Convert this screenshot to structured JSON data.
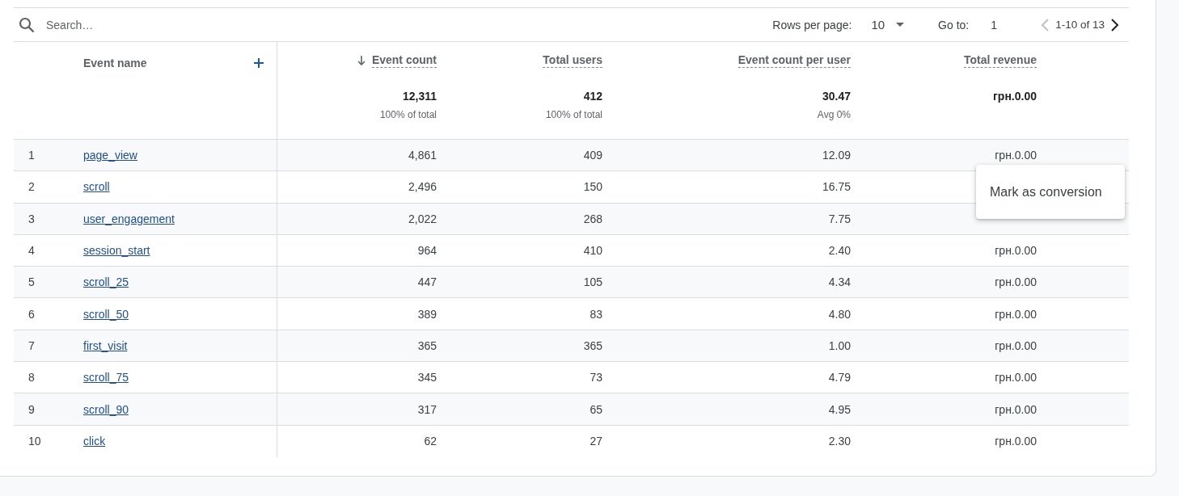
{
  "toolbar": {
    "search": {
      "placeholder": "Search…"
    },
    "rows_per_page_label": "Rows per page:",
    "rows_per_page": "10",
    "goto_label": "Go to:",
    "goto_value": "1",
    "range": "1-10 of 13",
    "previous_disabled": true,
    "next_disabled": false
  },
  "columns": [
    {
      "label": "Event name",
      "kind": "dimension"
    },
    {
      "label": "Event count",
      "kind": "metric",
      "sorted": true
    },
    {
      "label": "Total users",
      "kind": "metric",
      "sorted": false
    },
    {
      "label": "Event count per user",
      "kind": "metric",
      "sorted": false
    },
    {
      "label": "Total revenue",
      "kind": "metric",
      "sorted": false
    }
  ],
  "totals": [
    {
      "value": "12,311",
      "note": "100% of total"
    },
    {
      "value": "412",
      "note": "100% of total"
    },
    {
      "value": "30.47",
      "note": "Avg 0%"
    },
    {
      "value": "грн.0.00"
    }
  ],
  "rows": [
    {
      "rank": "1",
      "name": "page_view",
      "values": [
        "4,861",
        "409",
        "12.09",
        "грн.0.00"
      ]
    },
    {
      "rank": "2",
      "name": "scroll",
      "values": [
        "2,496",
        "150",
        "16.75"
      ]
    },
    {
      "rank": "3",
      "name": "user_engagement",
      "values": [
        "2,022",
        "268",
        "7.75"
      ]
    },
    {
      "rank": "4",
      "name": "session_start",
      "values": [
        "964",
        "410",
        "2.40",
        "грн.0.00"
      ]
    },
    {
      "rank": "5",
      "name": "scroll_25",
      "values": [
        "447",
        "105",
        "4.34",
        "грн.0.00"
      ]
    },
    {
      "rank": "6",
      "name": "scroll_50",
      "values": [
        "389",
        "83",
        "4.80",
        "грн.0.00"
      ]
    },
    {
      "rank": "7",
      "name": "first_visit",
      "values": [
        "365",
        "365",
        "1.00",
        "грн.0.00"
      ]
    },
    {
      "rank": "8",
      "name": "scroll_75",
      "values": [
        "345",
        "73",
        "4.79",
        "грн.0.00"
      ]
    },
    {
      "rank": "9",
      "name": "scroll_90",
      "values": [
        "317",
        "65",
        "4.95",
        "грн.0.00"
      ]
    },
    {
      "rank": "10",
      "name": "click",
      "values": [
        "62",
        "27",
        "2.30",
        "грн.0.00"
      ]
    }
  ],
  "context_menu": {
    "items": [
      "Mark as conversion"
    ]
  }
}
